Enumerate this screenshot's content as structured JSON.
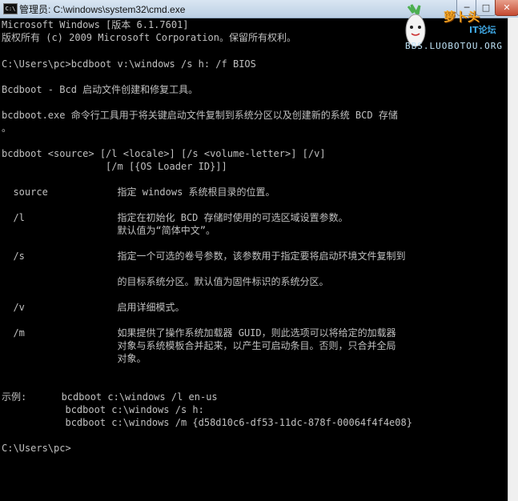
{
  "window": {
    "title": "管理员: C:\\windows\\system32\\cmd.exe",
    "icon_text": "C:\\",
    "minimize_glyph": "─",
    "maximize_glyph": "□",
    "close_glyph": "✕"
  },
  "watermark": {
    "name": "萝卜头",
    "sub": "IT论坛",
    "url": "BBS.LUOBOTOU.ORG"
  },
  "console": {
    "lines": [
      "Microsoft Windows [版本 6.1.7601]",
      "版权所有 (c) 2009 Microsoft Corporation。保留所有权利。",
      "C:\\Users\\pc>bcdboot v:\\windows /s h: /f BIOS",
      "Bcdboot - Bcd 启动文件创建和修复工具。",
      "bcdboot.exe 命令行工具用于将关键启动文件复制到系统分区以及创建新的系统 BCD 存储",
      "。",
      "bcdboot <source> [/l <locale>] [/s <volume-letter>] [/v]",
      "                  [/m [{OS Loader ID}]]",
      "  source            指定 windows 系统根目录的位置。",
      "  /l                指定在初始化 BCD 存储时使用的可选区域设置参数。",
      "                    默认值为“简体中文”。",
      "  /s                指定一个可选的卷号参数，该参数用于指定要将启动环境文件复制到",
      "                    的目标系统分区。默认值为固件标识的系统分区。",
      "  /v                启用详细模式。",
      "  /m                如果提供了操作系统加载器 GUID，则此选项可以将给定的加载器",
      "                    对象与系统模板合并起来，以产生可启动条目。否则，只合并全局",
      "                    对象。",
      "示例:      bcdboot c:\\windows /l en-us",
      "           bcdboot c:\\windows /s h:",
      "           bcdboot c:\\windows /m {d58d10c6-df53-11dc-878f-00064f4f4e08}",
      "C:\\Users\\pc>"
    ]
  }
}
